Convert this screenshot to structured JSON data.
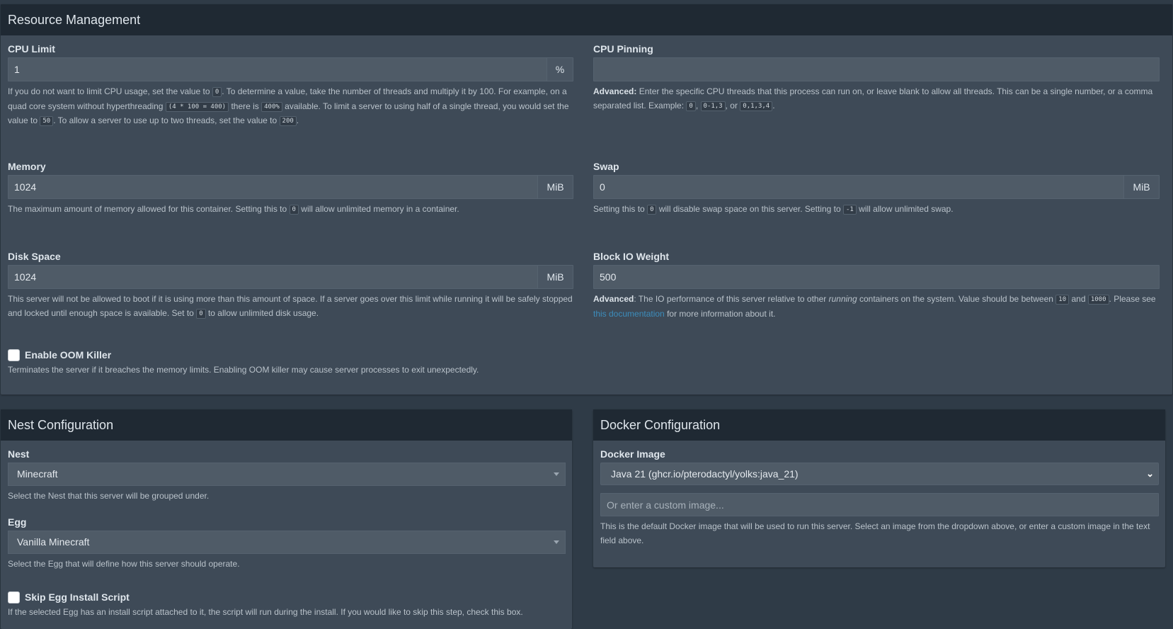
{
  "resource": {
    "title": "Resource Management",
    "cpu_limit": {
      "label": "CPU Limit",
      "value": "1",
      "unit": "%",
      "help_1": "If you do not want to limit CPU usage, set the value to",
      "code_1": "0",
      "help_2": ". To determine a value, take the number of threads and multiply it by 100. For example, on a quad core system without hyperthreading",
      "code_2": "(4 * 100 = 400)",
      "help_3": "there is",
      "code_3": "400%",
      "help_4": "available. To limit a server to using half of a single thread, you would set the value to",
      "code_4": "50",
      "help_5": ". To allow a server to use up to two threads, set the value to",
      "code_5": "200",
      "help_6": "."
    },
    "cpu_pinning": {
      "label": "CPU Pinning",
      "value": "",
      "help_bold": "Advanced:",
      "help_1": "Enter the specific CPU threads that this process can run on, or leave blank to allow all threads. This can be a single number, or a comma separated list. Example:",
      "code_1": "0",
      "sep_1": ",",
      "code_2": "0-1,3",
      "sep_2": ", or",
      "code_3": "0,1,3,4",
      "help_end": "."
    },
    "memory": {
      "label": "Memory",
      "value": "1024",
      "unit": "MiB",
      "help_1": "The maximum amount of memory allowed for this container. Setting this to",
      "code_1": "0",
      "help_2": "will allow unlimited memory in a container."
    },
    "swap": {
      "label": "Swap",
      "value": "0",
      "unit": "MiB",
      "help_1": "Setting this to",
      "code_1": "0",
      "help_2": "will disable swap space on this server. Setting to",
      "code_2": "-1",
      "help_3": "will allow unlimited swap."
    },
    "disk": {
      "label": "Disk Space",
      "value": "1024",
      "unit": "MiB",
      "help_1": "This server will not be allowed to boot if it is using more than this amount of space. If a server goes over this limit while running it will be safely stopped and locked until enough space is available. Set to",
      "code_1": "0",
      "help_2": "to allow unlimited disk usage."
    },
    "block_io": {
      "label": "Block IO Weight",
      "value": "500",
      "help_bold": "Advanced",
      "help_1": ": The IO performance of this server relative to other",
      "help_italic": "running",
      "help_2": "containers on the system. Value should be between",
      "code_1": "10",
      "help_3": "and",
      "code_2": "1000",
      "help_4": ". Please see",
      "link": "this documentation",
      "help_5": "for more information about it."
    },
    "oom": {
      "label": "Enable OOM Killer",
      "help": "Terminates the server if it breaches the memory limits. Enabling OOM killer may cause server processes to exit unexpectedly."
    }
  },
  "nest_config": {
    "title": "Nest Configuration",
    "nest": {
      "label": "Nest",
      "value": "Minecraft",
      "help": "Select the Nest that this server will be grouped under."
    },
    "egg": {
      "label": "Egg",
      "value": "Vanilla Minecraft",
      "help": "Select the Egg that will define how this server should operate."
    },
    "skip": {
      "label": "Skip Egg Install Script",
      "help": "If the selected Egg has an install script attached to it, the script will run during the install. If you would like to skip this step, check this box."
    }
  },
  "docker_config": {
    "title": "Docker Configuration",
    "image": {
      "label": "Docker Image",
      "value": "Java 21 (ghcr.io/pterodactyl/yolks:java_21)",
      "custom_placeholder": "Or enter a custom image...",
      "help": "This is the default Docker image that will be used to run this server. Select an image from the dropdown above, or enter a custom image in the text field above."
    }
  }
}
